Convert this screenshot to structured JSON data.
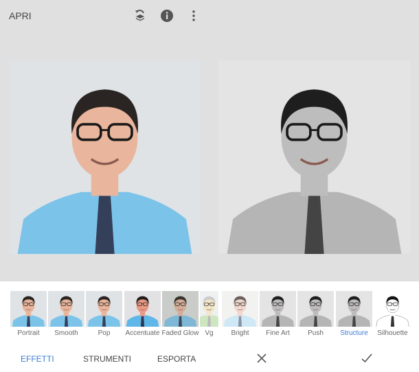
{
  "topbar": {
    "open_label": "APRI",
    "icons": [
      "history-layers-icon",
      "info-icon",
      "more-vert-icon"
    ]
  },
  "photos": [
    {
      "name": "original",
      "style": "color"
    },
    {
      "name": "preview",
      "style": "bw"
    }
  ],
  "filters": [
    {
      "label": "Portrait",
      "style": "color"
    },
    {
      "label": "Smooth",
      "style": "color"
    },
    {
      "label": "Pop",
      "style": "color"
    },
    {
      "label": "Accentuate",
      "style": "warm"
    },
    {
      "label": "Faded Glow",
      "style": "faded"
    },
    {
      "label": "Vg",
      "style": "glow"
    },
    {
      "label": "Bright",
      "style": "bright"
    },
    {
      "label": "Fine Art",
      "style": "bw"
    },
    {
      "label": "Push",
      "style": "bw"
    },
    {
      "label": "Structure",
      "style": "bw",
      "selected": true
    },
    {
      "label": "Silhouette",
      "style": "sil"
    }
  ],
  "bottom_nav": {
    "effects": "EFFETTI",
    "tools": "STRUMENTI",
    "export": "ESPORTA",
    "cancel_icon": "close-icon",
    "apply_icon": "check-icon"
  },
  "colors": {
    "accent": "#3b7bd6"
  }
}
